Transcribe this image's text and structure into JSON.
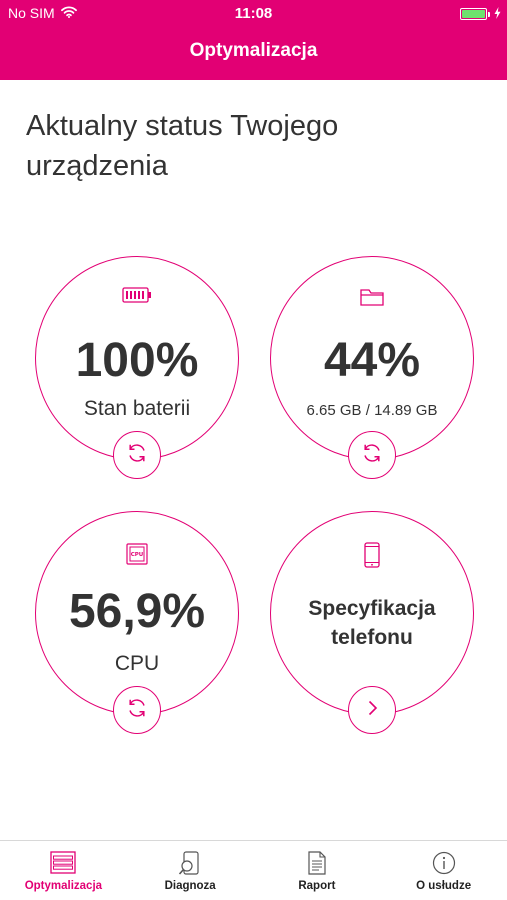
{
  "status_bar": {
    "carrier": "No SIM",
    "time": "11:08",
    "battery_level": 1.0
  },
  "nav": {
    "title": "Optymalizacja"
  },
  "main": {
    "heading": "Aktualny status Twojego urządzenia"
  },
  "tiles": {
    "battery": {
      "value": "100%",
      "label": "Stan baterii",
      "icon": "battery-icon",
      "action_icon": "refresh-icon"
    },
    "storage": {
      "value": "44%",
      "label": "6.65 GB / 14.89 GB",
      "icon": "folder-icon",
      "action_icon": "refresh-icon"
    },
    "cpu": {
      "value": "56,9%",
      "label": "CPU",
      "icon": "cpu-icon",
      "cpu_chip_text": "CPU",
      "action_icon": "refresh-icon"
    },
    "spec": {
      "line1": "Specyfikacja",
      "line2": "telefonu",
      "icon": "phone-icon",
      "action_icon": "chevron-right-icon"
    }
  },
  "tabbar": {
    "items": [
      {
        "label": "Optymalizacja",
        "icon": "optimize-icon",
        "active": true
      },
      {
        "label": "Diagnoza",
        "icon": "diagnose-icon",
        "active": false
      },
      {
        "label": "Raport",
        "icon": "report-icon",
        "active": false
      },
      {
        "label": "O usłudze",
        "icon": "info-icon",
        "active": false
      }
    ]
  },
  "colors": {
    "accent": "#e20074",
    "text": "#333333",
    "battery_fill": "#6ee36e"
  }
}
